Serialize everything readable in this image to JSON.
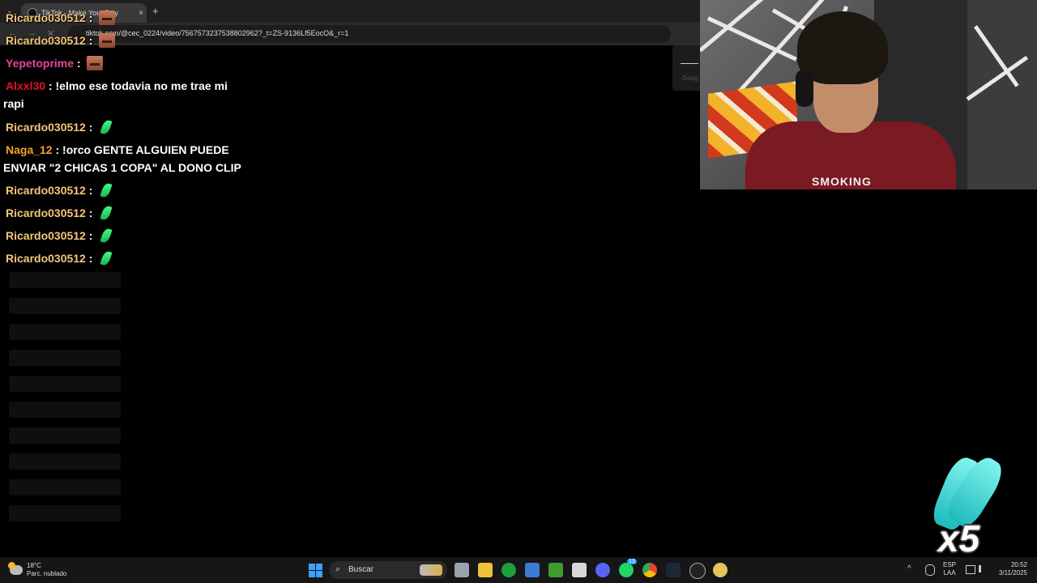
{
  "browser": {
    "tab_title": "TikTok - Make Your Day",
    "tab_close": "×",
    "new_tab": "+",
    "tab_menu": "⌄",
    "back": "←",
    "forward": "→",
    "reload": "✕",
    "url": "tiktok.com/@cec_0224/video/7567573237538802962?_t=ZS-9136Lf5EocO&_r=1",
    "side_text": "Goog"
  },
  "chat": {
    "messages": [
      {
        "user": "Ricardo030512",
        "color": "#f5c67a",
        "text": "",
        "emote": "face"
      },
      {
        "user": "Ricardo030512",
        "color": "#f5c67a",
        "text": "",
        "emote": "face"
      },
      {
        "user": "Yepetoprime",
        "color": "#e8459a",
        "text": "",
        "emote": "face"
      },
      {
        "user": "Alxxl30",
        "color": "#e0142c",
        "text": "!elmo ese todavia no me trae mi",
        "text2": "rapi",
        "emote": ""
      },
      {
        "user": "Ricardo030512",
        "color": "#f5c67a",
        "text": "",
        "emote": "leaf"
      },
      {
        "user": "Naga_12",
        "color": "#f2a32b",
        "text": "!orco GENTE ALGUIEN PUEDE",
        "text2": "ENVIAR \"2 CHICAS 1 COPA\" AL DONO CLIP",
        "emote": ""
      },
      {
        "user": "Ricardo030512",
        "color": "#f5c67a",
        "text": "",
        "emote": "leaf"
      },
      {
        "user": "Ricardo030512",
        "color": "#f5c67a",
        "text": "",
        "emote": "leaf"
      },
      {
        "user": "Ricardo030512",
        "color": "#f5c67a",
        "text": "",
        "emote": "leaf"
      },
      {
        "user": "Ricardo030512",
        "color": "#f5c67a",
        "text": "",
        "emote": "leaf"
      }
    ],
    "separator": " : "
  },
  "webcam": {
    "shirt_text": "SMOKING"
  },
  "overlay": {
    "multiplier": "x5",
    "sticker": "clapping-hands"
  },
  "taskbar": {
    "temperature": "18°C",
    "weather": "Parc. nublado",
    "search_label": "Buscar",
    "search_icon": "⌕",
    "discord_badge": "",
    "whatsapp_badge": "13",
    "lang_top": "ESP",
    "lang_bottom": "LAA",
    "time": "20:52",
    "date": "3/11/2025",
    "chevron": "^"
  }
}
